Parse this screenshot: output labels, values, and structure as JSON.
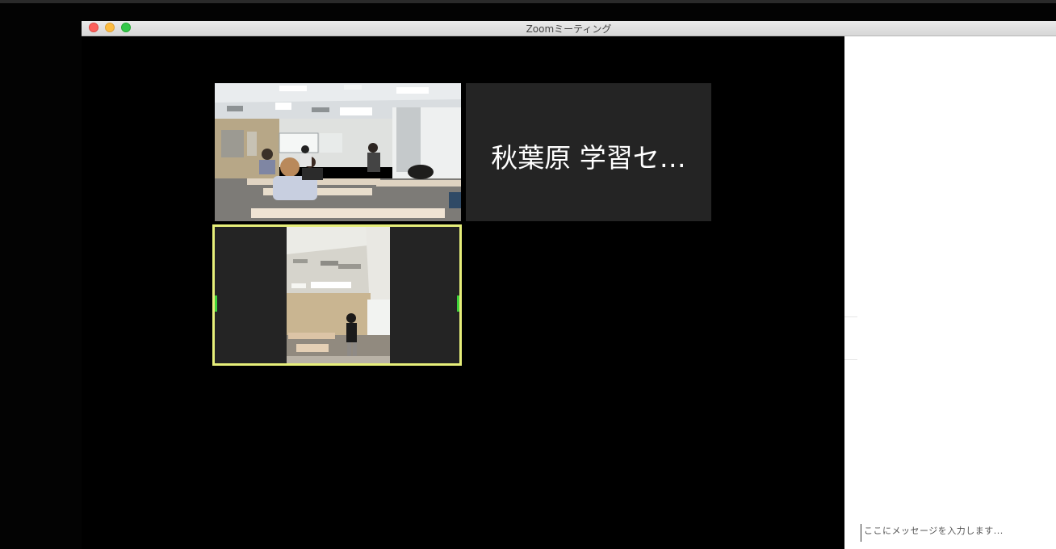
{
  "window": {
    "title": "Zoomミーティング"
  },
  "participants": [
    {
      "type": "video",
      "scene": "classroom-wide"
    },
    {
      "type": "name",
      "name": "秋葉原 学習セ…"
    },
    {
      "type": "video",
      "scene": "classroom-teacher",
      "active_speaker": true
    }
  ],
  "chat": {
    "input_placeholder": "ここにメッセージを入力します..."
  },
  "colors": {
    "active_speaker_border": "#e7ef7a",
    "tile_background": "#242424",
    "close": "#fc605c",
    "minimize": "#fdbc40",
    "maximize": "#34c84a"
  }
}
